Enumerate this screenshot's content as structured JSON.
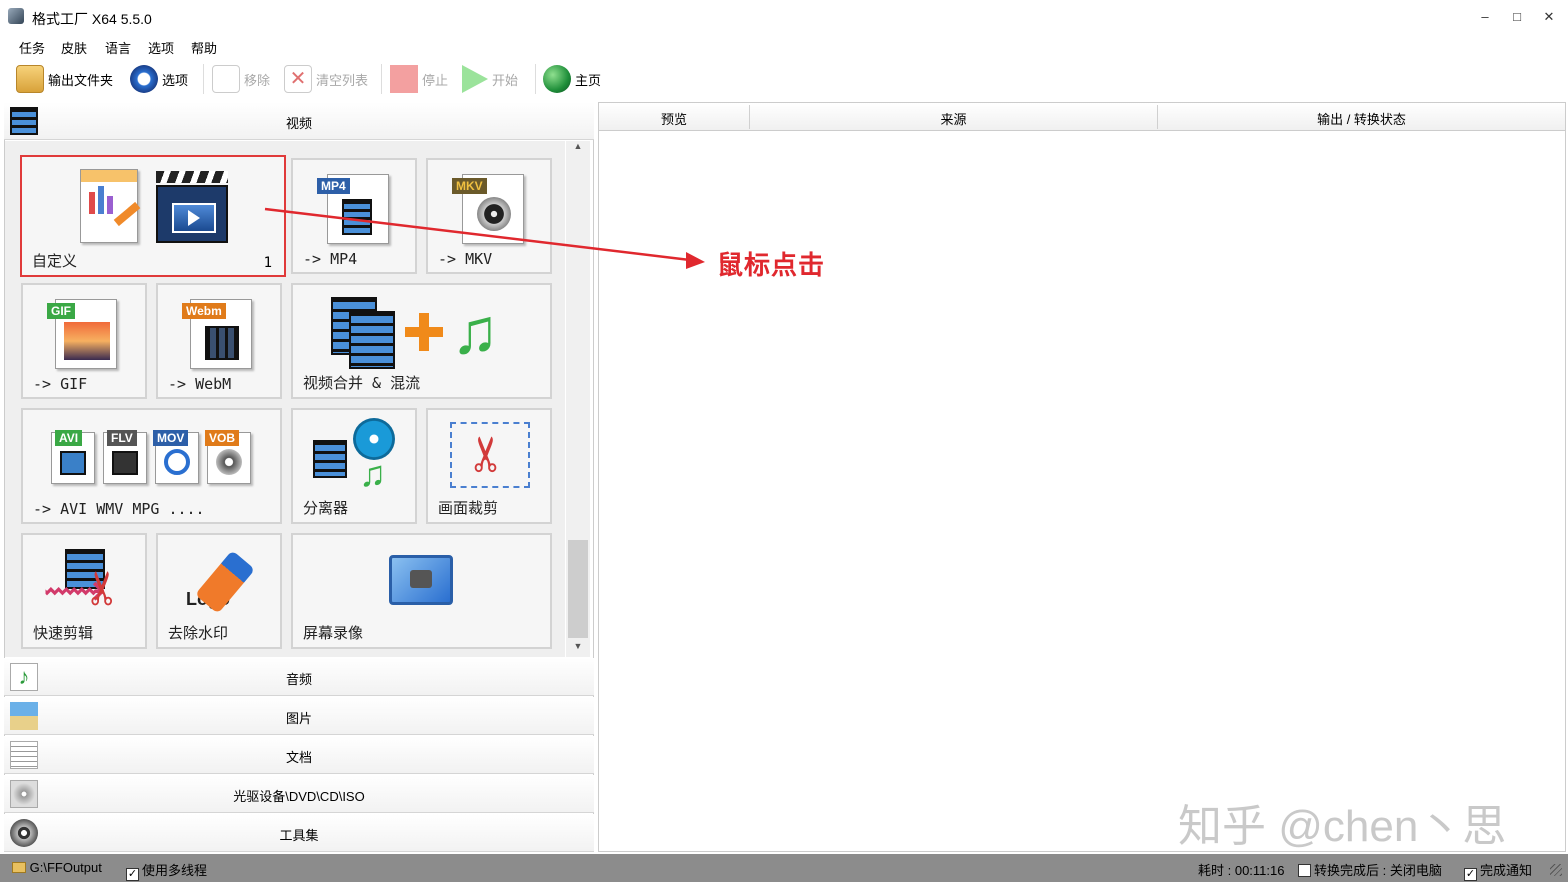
{
  "window": {
    "title": "格式工厂 X64 5.5.0",
    "minimize": "–",
    "maximize": "□",
    "close": "✕"
  },
  "menu": [
    "任务",
    "皮肤",
    "语言",
    "选项",
    "帮助"
  ],
  "toolbar": {
    "output_folder": "输出文件夹",
    "options": "选项",
    "remove": "移除",
    "clear_list": "清空列表",
    "stop": "停止",
    "start": "开始",
    "home": "主页"
  },
  "categories": {
    "video": "视频",
    "audio": "音频",
    "image": "图片",
    "document": "文档",
    "optical": "光驱设备\\DVD\\CD\\ISO",
    "tools": "工具集"
  },
  "tiles": {
    "custom": {
      "label": "自定义",
      "count": "1"
    },
    "mp4": {
      "label": "-> MP4",
      "badge": "MP4"
    },
    "mkv": {
      "label": "-> MKV",
      "badge": "MKV"
    },
    "gif": {
      "label": "-> GIF",
      "badge": "GIF"
    },
    "webm": {
      "label": "-> WebM",
      "badge": "Webm"
    },
    "merge": {
      "label": "视频合并 & 混流"
    },
    "formats": {
      "label": "-> AVI WMV MPG ....",
      "badges": [
        "AVI",
        "FLV",
        "MOV",
        "VOB"
      ]
    },
    "splitter": {
      "label": "分离器"
    },
    "crop": {
      "label": "画面裁剪"
    },
    "quick_cut": {
      "label": "快速剪辑"
    },
    "remove_watermark": {
      "label": "去除水印",
      "logo_text": "Logo"
    },
    "screen_record": {
      "label": "屏幕录像"
    }
  },
  "list_columns": [
    "预览",
    "来源",
    "输出 / 转换状态"
  ],
  "annotation": "鼠标点击",
  "watermark": "知乎 @chen丶思",
  "status": {
    "output_path": "G:\\FFOutput",
    "multithread": "使用多线程",
    "elapsed": "耗时 : 00:11:16",
    "after_convert": "转换完成后 : 关闭电脑",
    "notify": "完成通知",
    "check": "✓"
  },
  "colors": {
    "accent_red": "#e0282e",
    "mp4_badge": "#2d5fa8",
    "mkv_badge": "#6b5a2a",
    "gif_badge": "#3aa845",
    "webm_badge": "#e07b1a"
  }
}
